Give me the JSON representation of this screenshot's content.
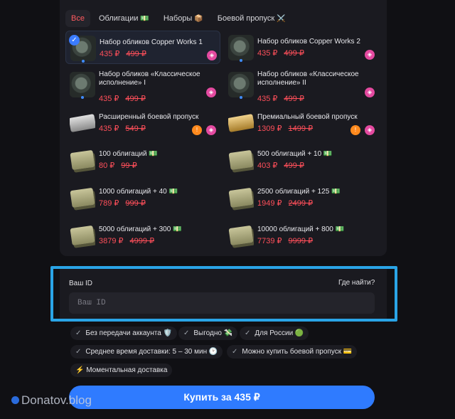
{
  "tabs": [
    {
      "label": "Все",
      "emoji": ""
    },
    {
      "label": "Облигации",
      "emoji": "💵"
    },
    {
      "label": "Наборы",
      "emoji": "📦"
    },
    {
      "label": "Боевой пропуск",
      "emoji": "⚔️"
    }
  ],
  "items": [
    {
      "name": "Набор обликов Copper Works 1",
      "price": "435 ₽",
      "old": "499 ₽",
      "selected": true
    },
    {
      "name": "Набор обликов Copper Works 2",
      "price": "435 ₽",
      "old": "499 ₽"
    },
    {
      "name": "Набор обликов «Классическое исполнение» I",
      "price": "435 ₽",
      "old": "499 ₽"
    },
    {
      "name": "Набор обликов «Классическое исполнение» II",
      "price": "435 ₽",
      "old": "499 ₽"
    },
    {
      "name": "Расширенный боевой пропуск",
      "price": "435 ₽",
      "old": "549 ₽"
    },
    {
      "name": "Премиальный боевой пропуск",
      "price": "1309 ₽",
      "old": "1499 ₽"
    },
    {
      "name": "100 облигаций 💵",
      "price": "80 ₽",
      "old": "99 ₽"
    },
    {
      "name": "500 облигаций + 10 💵",
      "price": "403 ₽",
      "old": "499 ₽"
    },
    {
      "name": "1000 облигаций + 40 💵",
      "price": "789 ₽",
      "old": "999 ₽"
    },
    {
      "name": "2500 облигаций + 125 💵",
      "price": "1949 ₽",
      "old": "2499 ₽"
    },
    {
      "name": "5000 облигаций + 300 💵",
      "price": "3879 ₽",
      "old": "4999 ₽"
    },
    {
      "name": "10000 облигаций + 800 💵",
      "price": "7739 ₽",
      "old": "9999 ₽"
    }
  ],
  "id_form": {
    "label": "Ваш ID",
    "help": "Где найти?",
    "placeholder": "Ваш ID"
  },
  "features": [
    "Без передачи аккаунта 🛡️",
    "Выгодно 💸",
    "Для России 🟢",
    "Среднее время доставки: 5 – 30 мин 🕑",
    "Можно купить боевой пропуск 💳",
    "⚡ Моментальная доставка"
  ],
  "buy_label": "Купить за 435 ₽",
  "watermark": "Donatov.blog",
  "colors": {
    "accent": "#2f7bff",
    "price": "#ff4f5a",
    "highlight": "#2aa4e6"
  }
}
